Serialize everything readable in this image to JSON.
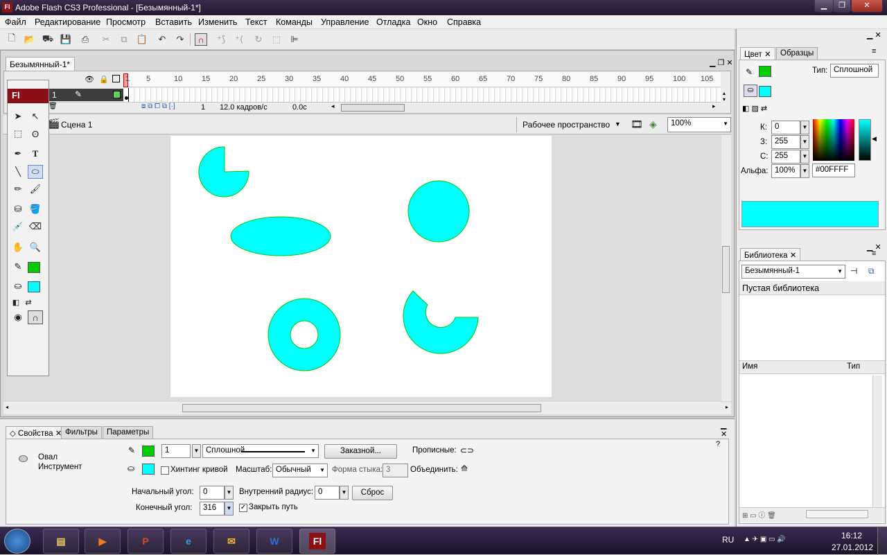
{
  "window": {
    "title": "Adobe Flash CS3 Professional - [Безымянный-1*]",
    "app_icon": "Fl"
  },
  "menu": [
    "Файл",
    "Редактирование",
    "Просмотр",
    "Вставить",
    "Изменить",
    "Текст",
    "Команды",
    "Управление",
    "Отладка",
    "Окно",
    "Справка"
  ],
  "document": {
    "tab": "Безымянный-1*"
  },
  "timeline": {
    "ruler": [
      "1",
      "5",
      "10",
      "15",
      "20",
      "25",
      "30",
      "35",
      "40",
      "45",
      "50",
      "55",
      "60",
      "65",
      "70",
      "75",
      "80",
      "85",
      "90",
      "95",
      "100",
      "105"
    ],
    "layer_name": "1",
    "current_frame": "1",
    "fps": "12.0 кадров/с",
    "time": "0.0с"
  },
  "scene": {
    "name": "Сцена 1",
    "workspace": "Рабочее пространство",
    "zoom": "100%"
  },
  "tools": {
    "title": "Fl"
  },
  "colors": {
    "stroke": "#00cc00",
    "fill": "#00ffff"
  },
  "properties": {
    "tabs": [
      "Свойства",
      "Фильтры",
      "Параметры"
    ],
    "tool_name": "Овал",
    "tool_type": "Инструмент",
    "stroke_width": "1",
    "stroke_style": "Сплошной",
    "custom_button": "Заказной...",
    "caps_label": "Прописные:",
    "hinting_label": "Хинтинг кривой",
    "scale_label": "Масштаб:",
    "scale_value": "Обычный",
    "miter_label": "Форма стыка:",
    "miter_value": "3",
    "join_label": "Объединить:",
    "start_angle_label": "Начальный угол:",
    "start_angle": "0",
    "inner_radius_label": "Внутренний радиус:",
    "inner_radius": "0",
    "reset_button": "Сброс",
    "end_angle_label": "Конечный угол:",
    "end_angle": "316",
    "close_path_label": "Закрыть путь"
  },
  "color_panel": {
    "tabs": [
      "Цвет",
      "Образцы"
    ],
    "type_label": "Тип:",
    "type_value": "Сплошной",
    "r_label": "К:",
    "r_value": "0",
    "g_label": "З:",
    "g_value": "255",
    "b_label": "С:",
    "b_value": "255",
    "alpha_label": "Альфа:",
    "alpha_value": "100%",
    "hex": "#00FFFF"
  },
  "library": {
    "tab": "Библиотека",
    "doc": "Безымянный-1",
    "empty": "Пустая библиотека",
    "col_name": "Имя",
    "col_type": "Тип"
  },
  "taskbar": {
    "lang": "RU",
    "time": "16:12",
    "date": "27.01.2012"
  }
}
